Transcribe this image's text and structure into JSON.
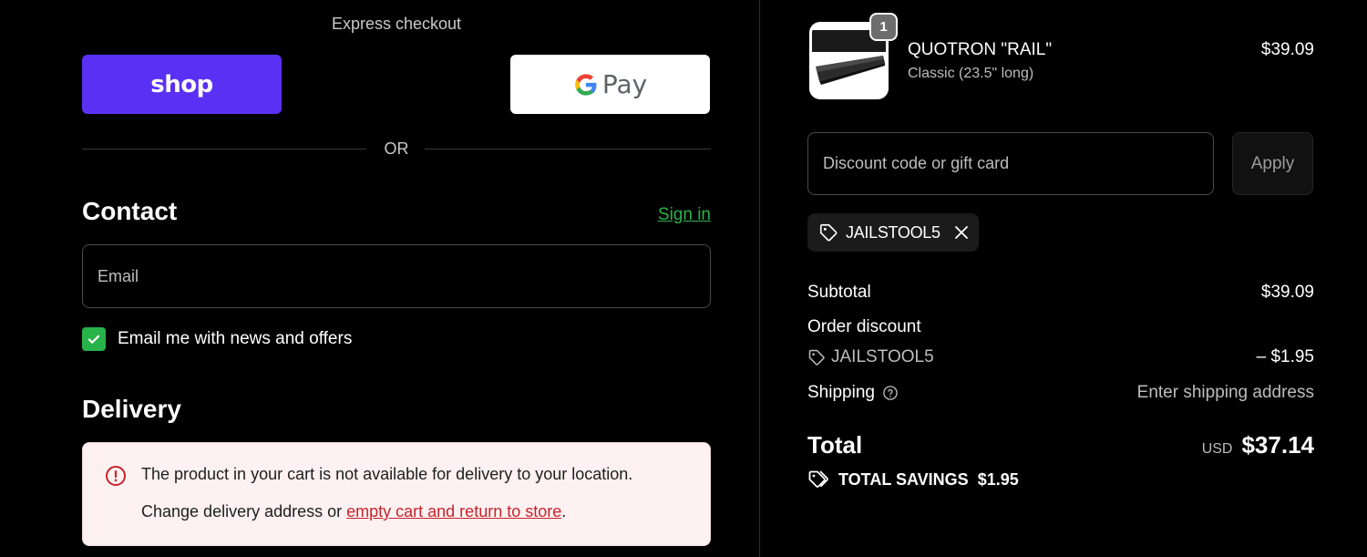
{
  "express": {
    "title": "Express checkout",
    "shop_label": "shop",
    "gpay_label": "Pay",
    "or_label": "OR"
  },
  "contact": {
    "title": "Contact",
    "sign_in": "Sign in",
    "email_placeholder": "Email",
    "newsletter_label": "Email me with news and offers",
    "newsletter_checked": true
  },
  "delivery": {
    "title": "Delivery",
    "error_message": "The product in your cart is not available for delivery to your location.",
    "error_sub_prefix": "Change delivery address or ",
    "error_link": "empty cart and return to store",
    "error_sub_suffix": "."
  },
  "cart": {
    "quantity": "1",
    "product_name": "QUOTRON \"RAIL\"",
    "product_variant": "Classic (23.5\" long)",
    "product_price": "$39.09"
  },
  "discount": {
    "placeholder": "Discount code or gift card",
    "apply_label": "Apply",
    "applied_code": "JAILSTOOL5"
  },
  "summary": {
    "subtotal_label": "Subtotal",
    "subtotal_value": "$39.09",
    "order_discount_label": "Order discount",
    "discount_code": "JAILSTOOL5",
    "discount_value": "– $1.95",
    "shipping_label": "Shipping",
    "shipping_value": "Enter shipping address",
    "total_label": "Total",
    "currency": "USD",
    "total_value": "$37.14",
    "savings_label": "TOTAL SAVINGS",
    "savings_value": "$1.95"
  },
  "colors": {
    "shop_purple": "#5a31f4",
    "link_green": "#2bb24c",
    "checkbox_green": "#27b24a",
    "error_red": "#c8232c",
    "error_bg": "#fdf1f1"
  },
  "icons": [
    "google-g-icon",
    "checkmark-icon",
    "alert-circle-icon",
    "tag-icon",
    "close-icon",
    "question-circle-icon",
    "tags-icon"
  ]
}
